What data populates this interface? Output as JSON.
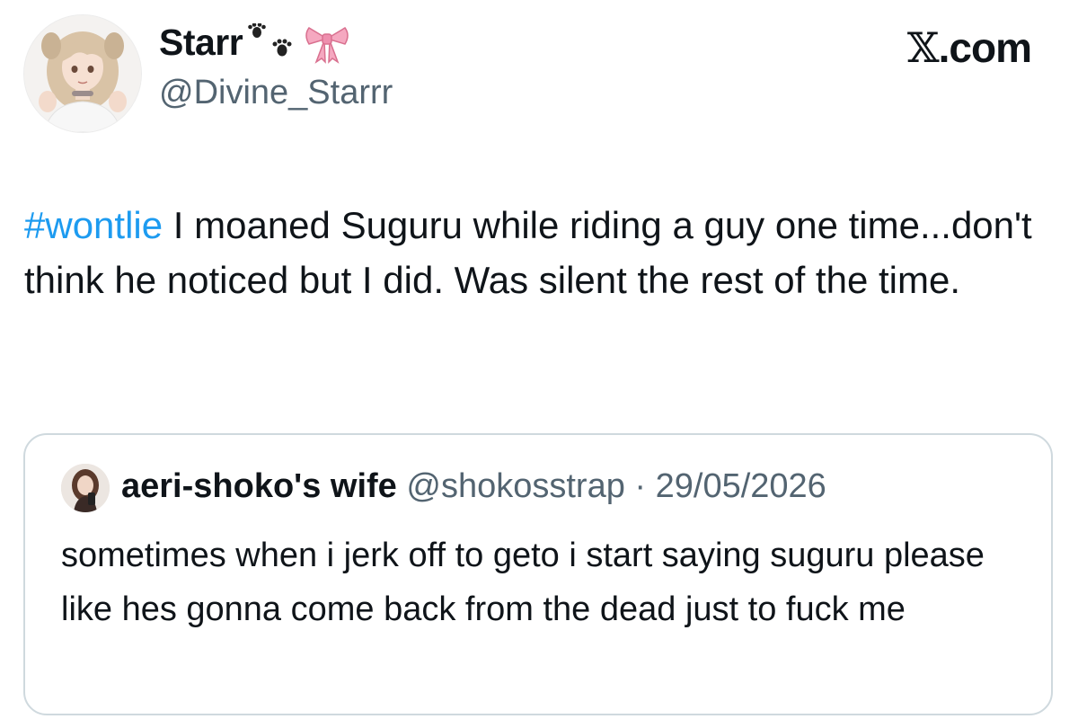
{
  "author": {
    "display_name": "Starr",
    "handle": "@Divine_Starrr",
    "name_emojis": [
      "paw-prints-emoji",
      "ribbon-emoji"
    ]
  },
  "brand": {
    "mark": "𝕏",
    "suffix": ".com"
  },
  "tweet": {
    "hashtag": "#wontlie",
    "text": " I moaned Suguru while riding a guy one time...don't think he noticed but I did. Was silent the rest of the time."
  },
  "quoted_tweet": {
    "display_name": "aeri-shoko's wife",
    "handle": "@shokosstrap",
    "separator": " · ",
    "date": "29/05/2026",
    "text": "sometimes when i jerk off to geto i start saying suguru please  like hes gonna come back from the dead just to fuck me"
  },
  "colors": {
    "hashtag": "#1d9bf0",
    "secondary_text": "#536471",
    "border": "#cfd9de"
  }
}
